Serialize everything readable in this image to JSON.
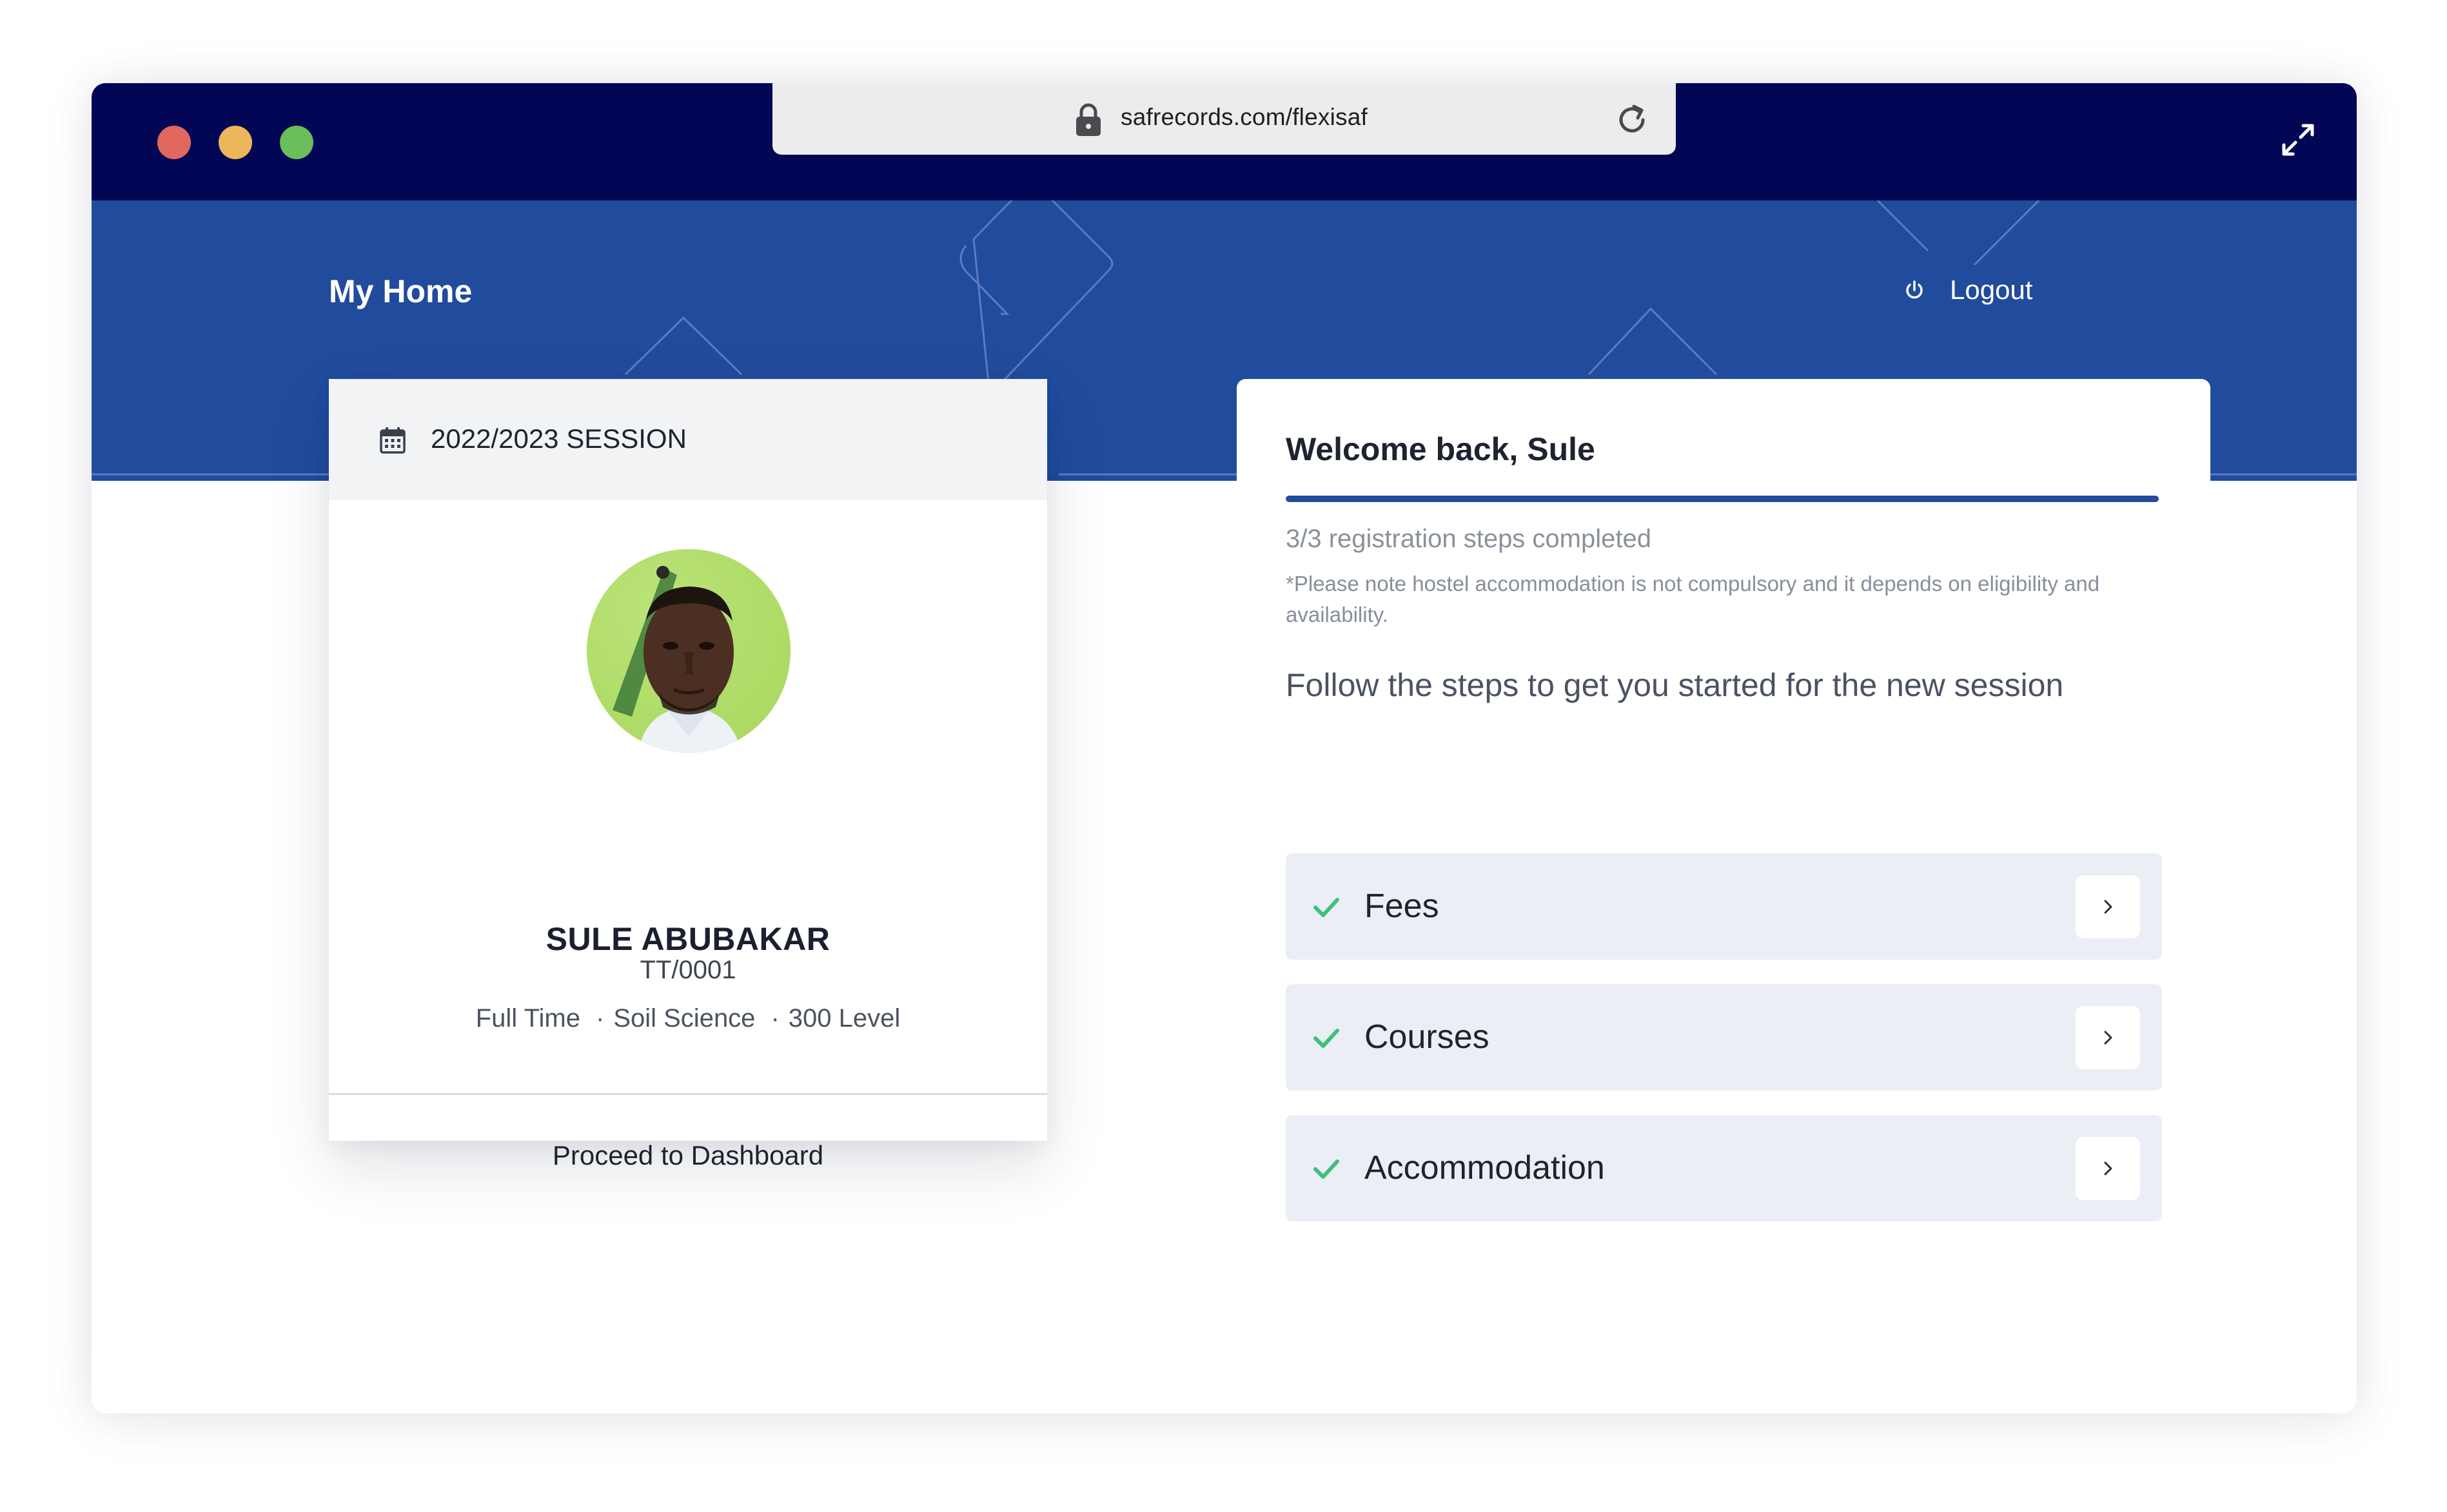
{
  "browser": {
    "url": "safrecords.com/flexisaf"
  },
  "header": {
    "title": "My Home",
    "logout_label": "Logout"
  },
  "profile": {
    "session": "2022/2023 SESSION",
    "name": "SULE ABUBAKAR",
    "id": "TT/0001",
    "mode": "Full Time",
    "department": "Soil Science",
    "level": "300 Level",
    "proceed_label": "Proceed to Dashboard"
  },
  "welcome": {
    "title": "Welcome back, Sule",
    "progress": 1.0,
    "steps_completed": "3/3 registration steps completed",
    "note": "*Please note hostel accommodation is not compulsory and it depends on eligibility and availability.",
    "follow": "Follow the steps to get you started for the new session",
    "steps": [
      {
        "label": "Fees",
        "status": "completed"
      },
      {
        "label": "Courses",
        "status": "completed"
      },
      {
        "label": "Accommodation",
        "status": "completed"
      }
    ]
  },
  "colors": {
    "titlebar": "#030654",
    "hero": "#214b9d",
    "accent": "#214b9d",
    "check": "#3fbf7a",
    "step_bg": "#ebeef5"
  },
  "icons": {
    "lock": "lock-icon",
    "reload": "reload-icon",
    "expand": "expand-icon",
    "power": "power-icon",
    "calendar": "calendar-icon",
    "check": "check-icon",
    "chevron": "chevron-right-icon"
  }
}
